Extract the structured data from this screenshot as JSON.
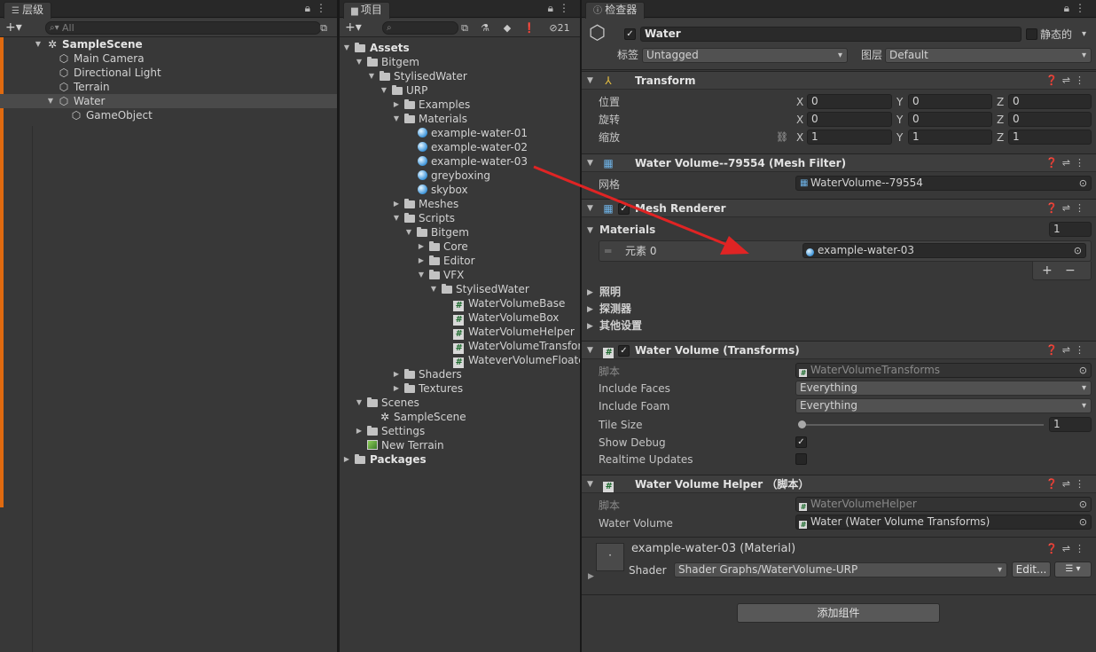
{
  "hierarchy": {
    "tab": "层级",
    "search_placeholder": "All",
    "scene": "SampleScene",
    "items": [
      {
        "label": "Main Camera"
      },
      {
        "label": "Directional Light"
      },
      {
        "label": "Terrain"
      },
      {
        "label": "Water"
      },
      {
        "label": "GameObject"
      }
    ]
  },
  "project": {
    "tab": "项目",
    "hidden_count": "21",
    "tree": {
      "assets": "Assets",
      "bitgem": "Bitgem",
      "stylised_water": "StylisedWater",
      "urp": "URP",
      "examples": "Examples",
      "materials": "Materials",
      "mat1": "example-water-01",
      "mat2": "example-water-02",
      "mat3": "example-water-03",
      "mat4": "greyboxing",
      "mat5": "skybox",
      "meshes": "Meshes",
      "scripts": "Scripts",
      "bitgem2": "Bitgem",
      "core": "Core",
      "editor": "Editor",
      "vfx": "VFX",
      "stylised_water2": "StylisedWater",
      "s1": "WaterVolumeBase",
      "s2": "WaterVolumeBox",
      "s3": "WaterVolumeHelper",
      "s4": "WaterVolumeTransforms",
      "s5": "WateverVolumeFloater",
      "shaders": "Shaders",
      "textures": "Textures",
      "scenes": "Scenes",
      "sample_scene": "SampleScene",
      "settings": "Settings",
      "new_terrain": "New Terrain",
      "packages": "Packages"
    }
  },
  "inspector": {
    "tab": "检查器",
    "object_name": "Water",
    "static_label": "静态的",
    "tag_label": "标签",
    "tag_value": "Untagged",
    "layer_label": "图层",
    "layer_value": "Default",
    "transform": {
      "title": "Transform",
      "position_label": "位置",
      "rotation_label": "旋转",
      "scale_label": "缩放",
      "x": "X",
      "y": "Y",
      "z": "Z",
      "position": [
        "0",
        "0",
        "0"
      ],
      "rotation": [
        "0",
        "0",
        "0"
      ],
      "scale": [
        "1",
        "1",
        "1"
      ]
    },
    "mesh_filter": {
      "title": "Water Volume--79554 (Mesh Filter)",
      "mesh_label": "网格",
      "mesh_value": "WaterVolume--79554"
    },
    "mesh_renderer": {
      "title": "Mesh Renderer",
      "materials_label": "Materials",
      "materials_count": "1",
      "element_label": "元素 0",
      "element_value": "example-water-03",
      "plus": "+",
      "minus": "−",
      "lighting": "照明",
      "probes": "探测器",
      "additional": "其他设置"
    },
    "water_volume": {
      "title": "Water  Volume (Transforms)",
      "script_label": "脚本",
      "script_value": "WaterVolumeTransforms",
      "include_faces_label": "Include Faces",
      "include_faces_value": "Everything",
      "include_foam_label": "Include Foam",
      "include_foam_value": "Everything",
      "tile_size_label": "Tile Size",
      "tile_size_value": "1",
      "show_debug_label": "Show Debug",
      "realtime_label": "Realtime Updates"
    },
    "helper": {
      "title": "Water Volume Helper （脚本）",
      "script_label": "脚本",
      "script_value": "WaterVolumeHelper",
      "volume_label": "Water Volume",
      "volume_value": "Water (Water Volume Transforms)"
    },
    "material": {
      "name": "example-water-03 (Material)",
      "shader_label": "Shader",
      "shader_value": "Shader Graphs/WaterVolume-URP",
      "edit_button": "Edit..."
    },
    "add_component": "添加组件"
  },
  "colors": {
    "annotation_arrow": "#e02424",
    "panel": "#383838",
    "field": "#2a2a2a"
  }
}
